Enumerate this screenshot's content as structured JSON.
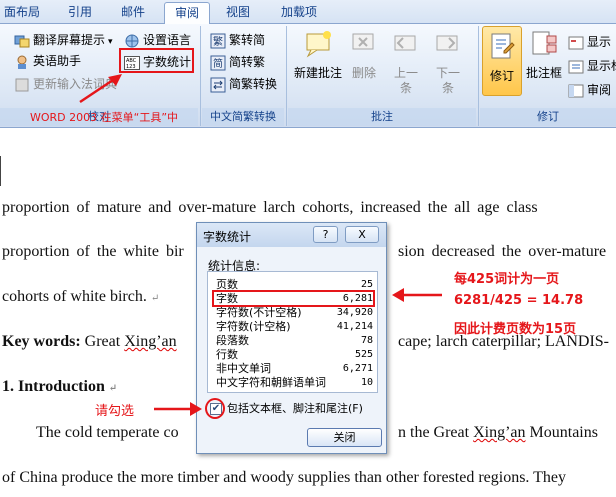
{
  "tabs": [
    {
      "label": "面布局"
    },
    {
      "label": "引用"
    },
    {
      "label": "邮件"
    },
    {
      "label": "审阅",
      "active": true
    },
    {
      "label": "视图"
    },
    {
      "label": "加载项"
    }
  ],
  "ribbon": {
    "proofing": {
      "translate_tip": "翻译屏幕提示",
      "set_language": "设置语言",
      "english_assistant": "英语助手",
      "word_count": "字数统计",
      "update_ime": "更新输入法词典",
      "footer": "校对"
    },
    "chinese_conversion": {
      "to_simplified": "繁转简",
      "to_traditional": "简转繁",
      "conversion": "简繁转换",
      "footer": "中文简繁转换"
    },
    "comments": {
      "new_comment": "新建批注",
      "delete": "删除",
      "previous": "上一\n条",
      "previous_l1": "上一",
      "previous_l2": "条",
      "next_l1": "下一",
      "next_l2": "条",
      "footer": "批注"
    },
    "tracking": {
      "track_changes": "修订",
      "balloons": "批注框",
      "display": "显示",
      "show_markup": "显示标",
      "reviewing_pane": "审阅",
      "footer": "修订"
    }
  },
  "annotations": {
    "word2003_note": "WORD 2003 在菜单“工具”中",
    "per_page_note": "每425词计为一页",
    "calc_note": "6281/425 = 14.78",
    "pages_note": "因此计费页数为15页",
    "check_note": "请勾选",
    "accent_color": "#e5161a"
  },
  "document": {
    "line1": "proportion  of  mature  and  over-mature  larch  cohorts,  increased  the  all  age  class",
    "line2_a": "proportion  of  the  white  bir",
    "line2_b": "sion  decreased  the  over-mature",
    "line3": "cohorts of white birch.",
    "keywords_label": "Key words:",
    "keywords_a": "Great ",
    "keywords_xingan": "Xing’an",
    "keywords_b": "cape; larch caterpillar; LANDIS-",
    "intro_heading": "1. Introduction",
    "para_a": "The cold temperate co",
    "para_b": "n the Great ",
    "para_b_xingan": "Xing’an",
    "para_b_end": " Mountains",
    "line_last": "of China produce the more timber and woody supplies than other forested regions. They"
  },
  "dialog": {
    "title": "字数统计",
    "help_label": "?",
    "close_label": "X",
    "stats_label": "统计信息:",
    "stats": [
      {
        "label": "页数",
        "value": "25"
      },
      {
        "label": "字数",
        "value": "6,281",
        "highlight": true
      },
      {
        "label": "字符数(不计空格)",
        "value": "34,920"
      },
      {
        "label": "字符数(计空格)",
        "value": "41,214"
      },
      {
        "label": "段落数",
        "value": "78"
      },
      {
        "label": "行数",
        "value": "525"
      },
      {
        "label": "非中文单词",
        "value": "6,271"
      },
      {
        "label": "中文字符和朝鲜语单词",
        "value": "10"
      }
    ],
    "checkbox_label": "包括文本框、脚注和尾注(F)",
    "checkbox_checked": true,
    "close_button": "关闭"
  }
}
